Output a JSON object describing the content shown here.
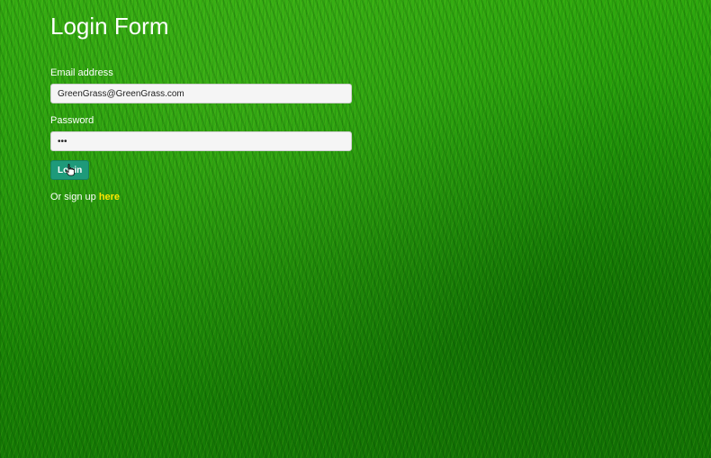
{
  "form": {
    "title": "Login Form",
    "email_label": "Email address",
    "email_value": "GreenGrass@GreenGrass.com",
    "password_label": "Password",
    "password_value": "pwd",
    "login_label": "Login",
    "signup_prefix": "Or sign up ",
    "signup_link": "here"
  },
  "colors": {
    "button": "#1e9a7a",
    "link": "#ffe600",
    "background": "#229a0a"
  },
  "icons": {
    "cursor": "hand-pointer-icon"
  }
}
